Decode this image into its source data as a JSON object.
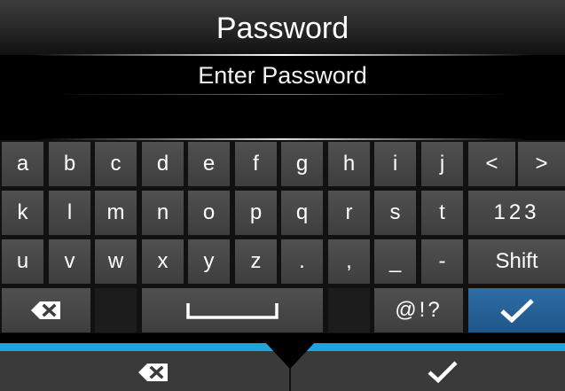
{
  "header": {
    "title": "Password"
  },
  "prompt": {
    "text": "Enter Password"
  },
  "password": {
    "value": ""
  },
  "keyboard": {
    "row1": [
      "a",
      "b",
      "c",
      "d",
      "e",
      "f",
      "g",
      "h",
      "i",
      "j"
    ],
    "row2": [
      "k",
      "l",
      "m",
      "n",
      "o",
      "p",
      "q",
      "r",
      "s",
      "t"
    ],
    "row3": [
      "u",
      "v",
      "w",
      "x",
      "y",
      "z",
      ".",
      ",",
      "_",
      "-"
    ],
    "left_arrow": "<",
    "right_arrow": ">",
    "numeric_label": "123",
    "shift_label": "Shift",
    "symbols_label": "@!?",
    "backspace_icon": "backspace-icon",
    "space_icon": "space-icon",
    "check_icon": "check-icon"
  },
  "bottom_bar": {
    "cancel_icon": "backspace-icon",
    "confirm_icon": "check-icon"
  },
  "colors": {
    "accent_blue": "#1fa4e2",
    "ok_key": "#2a66a0",
    "key_bg": "#484848",
    "bottom_bar": "#3a3a3a"
  }
}
